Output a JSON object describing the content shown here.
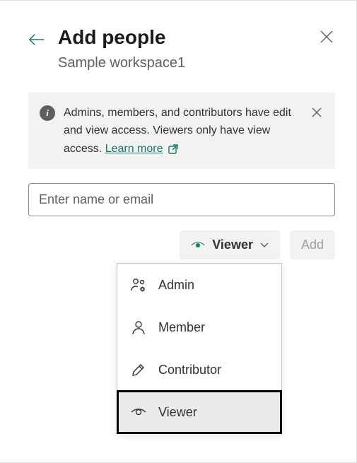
{
  "header": {
    "title": "Add people",
    "subtitle": "Sample workspace1"
  },
  "info": {
    "text": "Admins, members, and contributors have edit and view access. Viewers only have view access. ",
    "learn_more": "Learn more "
  },
  "input": {
    "placeholder": "Enter name or email"
  },
  "actions": {
    "role_label": "Viewer",
    "add_label": "Add"
  },
  "roles": [
    {
      "key": "admin",
      "label": "Admin",
      "icon": "people-gear"
    },
    {
      "key": "member",
      "label": "Member",
      "icon": "person"
    },
    {
      "key": "contributor",
      "label": "Contributor",
      "icon": "edit"
    },
    {
      "key": "viewer",
      "label": "Viewer",
      "icon": "eye",
      "selected": true
    }
  ],
  "colors": {
    "accent": "#0f7a6c"
  }
}
